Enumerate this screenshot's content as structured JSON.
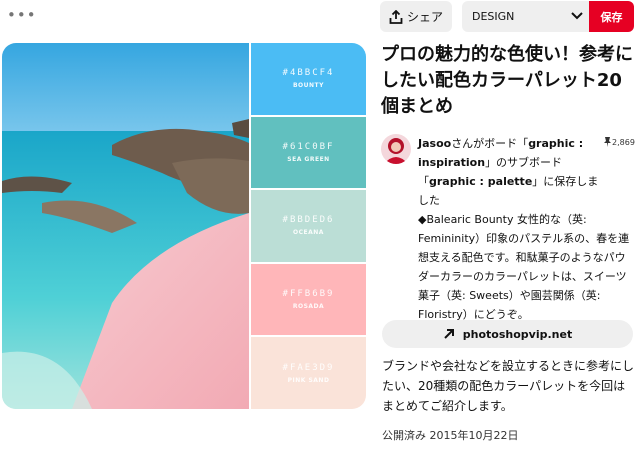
{
  "header": {
    "more_icon": "more-icon",
    "share_label": "シェア",
    "board_selected": "DESIGN",
    "save_label": "保存"
  },
  "pin": {
    "title": "プロの魅力的な色使い！参考にしたい配色カラーパレット20個まとめ",
    "palette": [
      {
        "hex": "#4BBCF4",
        "name": "BOUNTY",
        "color": "#4bbcf4"
      },
      {
        "hex": "#61C0BF",
        "name": "SEA GREEN",
        "color": "#61c0bf"
      },
      {
        "hex": "#BBDED6",
        "name": "OCEANA",
        "color": "#bbded6"
      },
      {
        "hex": "#FFB6B9",
        "name": "ROSADA",
        "color": "#ffb6b9"
      },
      {
        "hex": "#FAE3D9",
        "name": "PINK SAND",
        "color": "#fae3d9"
      }
    ]
  },
  "save_info": {
    "user": "Jasoo",
    "text1": "さんがボード「",
    "board": "graphic : inspiration",
    "text2": "」のサブボード「",
    "subboard": "graphic : palette",
    "text3": "」に保存しました",
    "pin_count": "2,869"
  },
  "repin_description": "◆Balearic Bounty 女性的な（英: Femininity）印象のパステル系の、春を連想支える配色です。和駄菓子のようなパウダーカラーのカラーパレットは、スイーツ菓子（英: Sweets）や園芸関係（英: Floristry）にどうぞ。",
  "link": {
    "label": "photoshopvip.net"
  },
  "description": "ブランドや会社などを設立するときに参考にしたい、20種類の配色カラーパレットを今回はまとめてご紹介します。",
  "published": "公開済み 2015年10月22日",
  "colors": {
    "save": "#e60023",
    "button_bg": "#efefef"
  }
}
